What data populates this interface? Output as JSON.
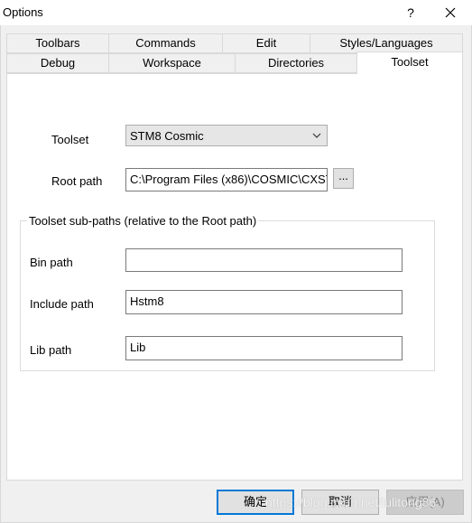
{
  "window": {
    "title": "Options",
    "help_label": "?"
  },
  "tabs": {
    "row1": [
      "Toolbars",
      "Commands",
      "Edit",
      "Styles/Languages"
    ],
    "row2": [
      "Debug",
      "Workspace",
      "Directories",
      "Toolset"
    ],
    "active": "Toolset"
  },
  "toolset": {
    "label": "Toolset",
    "selected": "STM8 Cosmic",
    "root_label": "Root path",
    "root_value": "C:\\Program Files (x86)\\COSMIC\\CXST",
    "browse_label": "..."
  },
  "subpaths": {
    "group_title": "Toolset sub-paths (relative to the Root path)",
    "bin_label": "Bin path",
    "bin_value": "",
    "include_label": "Include path",
    "include_value": "Hstm8",
    "lib_label": "Lib path",
    "lib_value": "Lib"
  },
  "buttons": {
    "ok": "确定",
    "cancel": "取消",
    "apply": "应用(A)"
  },
  "watermark": "https://blog.csdn.net/lulitong86"
}
